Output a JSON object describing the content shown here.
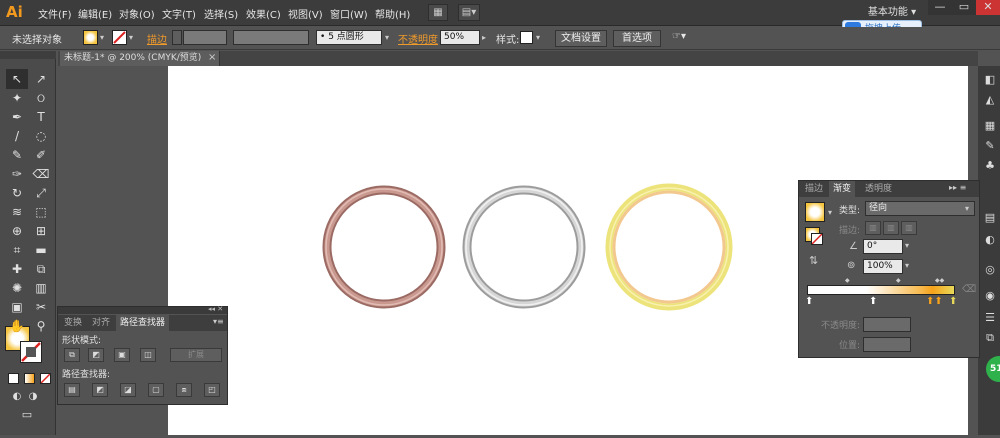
{
  "app": {
    "logo": "Ai"
  },
  "menu": [
    "文件(F)",
    "编辑(E)",
    "对象(O)",
    "文字(T)",
    "选择(S)",
    "效果(C)",
    "视图(V)",
    "窗口(W)",
    "帮助(H)"
  ],
  "workspace": "基本功能 ▾",
  "window_controls": [
    "—",
    "▭",
    "✕"
  ],
  "upload_button": "拖拽上传",
  "control_bar": {
    "selection_status": "未选择对象",
    "stroke_label": "描边",
    "brush_value": "5 点圆形",
    "opacity_label": "不透明度",
    "opacity_value": "50%",
    "style_label": "样式:",
    "doc_setup": "文档设置",
    "preferences": "首选项"
  },
  "document_tab": {
    "title": "未标题-1* @ 200% (CMYK/预览)",
    "close": "×"
  },
  "toolbar_tools": [
    "selection-tool",
    "direct-selection-tool",
    "magic-wand-tool",
    "lasso-tool",
    "pen-tool",
    "type-tool",
    "line-tool",
    "ellipse-tool",
    "paintbrush-tool",
    "pencil-tool",
    "blob-brush-tool",
    "eraser-tool",
    "rotate-tool",
    "scale-tool",
    "warp-tool",
    "free-transform-tool",
    "shape-builder-tool",
    "perspective-grid-tool",
    "mesh-tool",
    "gradient-tool",
    "eyedropper-tool",
    "blend-tool",
    "symbol-sprayer-tool",
    "column-graph-tool",
    "artboard-tool",
    "slice-tool",
    "hand-tool",
    "zoom-tool"
  ],
  "pathfinder_panel": {
    "tabs": [
      "变换",
      "对齐",
      "路径查找器"
    ],
    "shape_modes_label": "形状模式:",
    "expand_button": "扩展",
    "pathfinders_label": "路径查找器:"
  },
  "gradient_panel": {
    "tabs": [
      "描边",
      "渐变",
      "透明度"
    ],
    "type_label": "类型:",
    "type_value": "径向",
    "stroke_label": "描边:",
    "angle_value": "0°",
    "aspect_value": "100%",
    "opacity_label": "不透明度:",
    "position_label": "位置:"
  },
  "rings": [
    {
      "name": "copper-ring",
      "outer": "#9a6a63",
      "inner": "#c99990",
      "highlight": "#e2bcb3"
    },
    {
      "name": "silver-ring",
      "outer": "#9c9c9c",
      "inner": "#d6d6d6",
      "highlight": "#f1f1f1"
    },
    {
      "name": "gold-ring",
      "outer": "#ece37a",
      "inner": "#f3c88f",
      "highlight": "#f8f1b0"
    }
  ],
  "gradient_colors": [
    "#ffffff",
    "#f6a21a",
    "#f7b84a",
    "#e9d95a"
  ],
  "badge": "51"
}
